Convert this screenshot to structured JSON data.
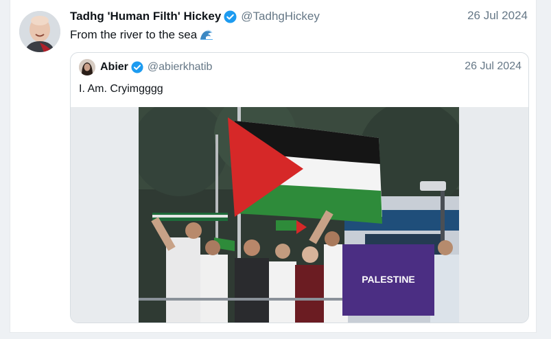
{
  "tweet": {
    "display_name": "Tadhg 'Human Filth' Hickey",
    "handle": "@TadhgHickey",
    "date": "26 Jul 2024",
    "text": "From the river to the sea",
    "emoji_icon": "wave-icon"
  },
  "quoted_tweet": {
    "display_name": "Abier",
    "handle": "@abierkhatib",
    "date": "26 Jul 2024",
    "text": "I. Am. Cryimgggg",
    "photo_banner": "PALESTINE"
  },
  "colors": {
    "verified": "#1d9bf0",
    "muted_text": "#657786",
    "flag_red": "#d62828",
    "flag_green": "#2e8b3a",
    "banner_purple": "#4b2e83"
  }
}
